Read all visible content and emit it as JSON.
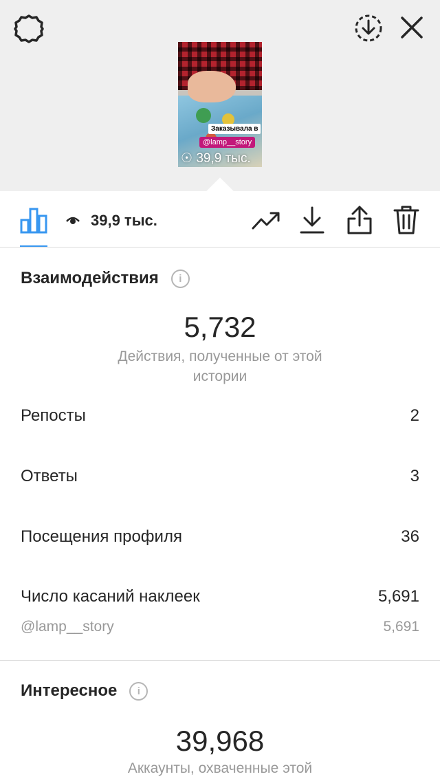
{
  "header": {
    "settings_icon": "gear-icon",
    "save_icon": "download-circle-icon",
    "close_icon": "close-icon"
  },
  "story_preview": {
    "sticker_text": "Заказывала в",
    "mention_sticker": "@lamp__story",
    "views_overlay": "39,9 тыс."
  },
  "toolbar": {
    "insights_icon": "bar-chart-icon",
    "views_icon": "eye-icon",
    "views": "39,9 тыс.",
    "promote_icon": "trend-up-icon",
    "download_icon": "download-icon",
    "share_icon": "share-icon",
    "delete_icon": "trash-icon",
    "accent_color": "#3897f0"
  },
  "interactions": {
    "title": "Взаимодействия",
    "total": "5,732",
    "caption": "Действия, полученные от этой истории",
    "rows": [
      {
        "label": "Репосты",
        "value": "2"
      },
      {
        "label": "Ответы",
        "value": "3"
      },
      {
        "label": "Посещения профиля",
        "value": "36"
      },
      {
        "label": "Число касаний наклеек",
        "value": "5,691"
      }
    ],
    "sticker_detail": {
      "label": "@lamp__story",
      "value": "5,691"
    }
  },
  "discovery": {
    "title": "Интересное",
    "total": "39,968",
    "caption": "Аккаунты, охваченные этой"
  }
}
